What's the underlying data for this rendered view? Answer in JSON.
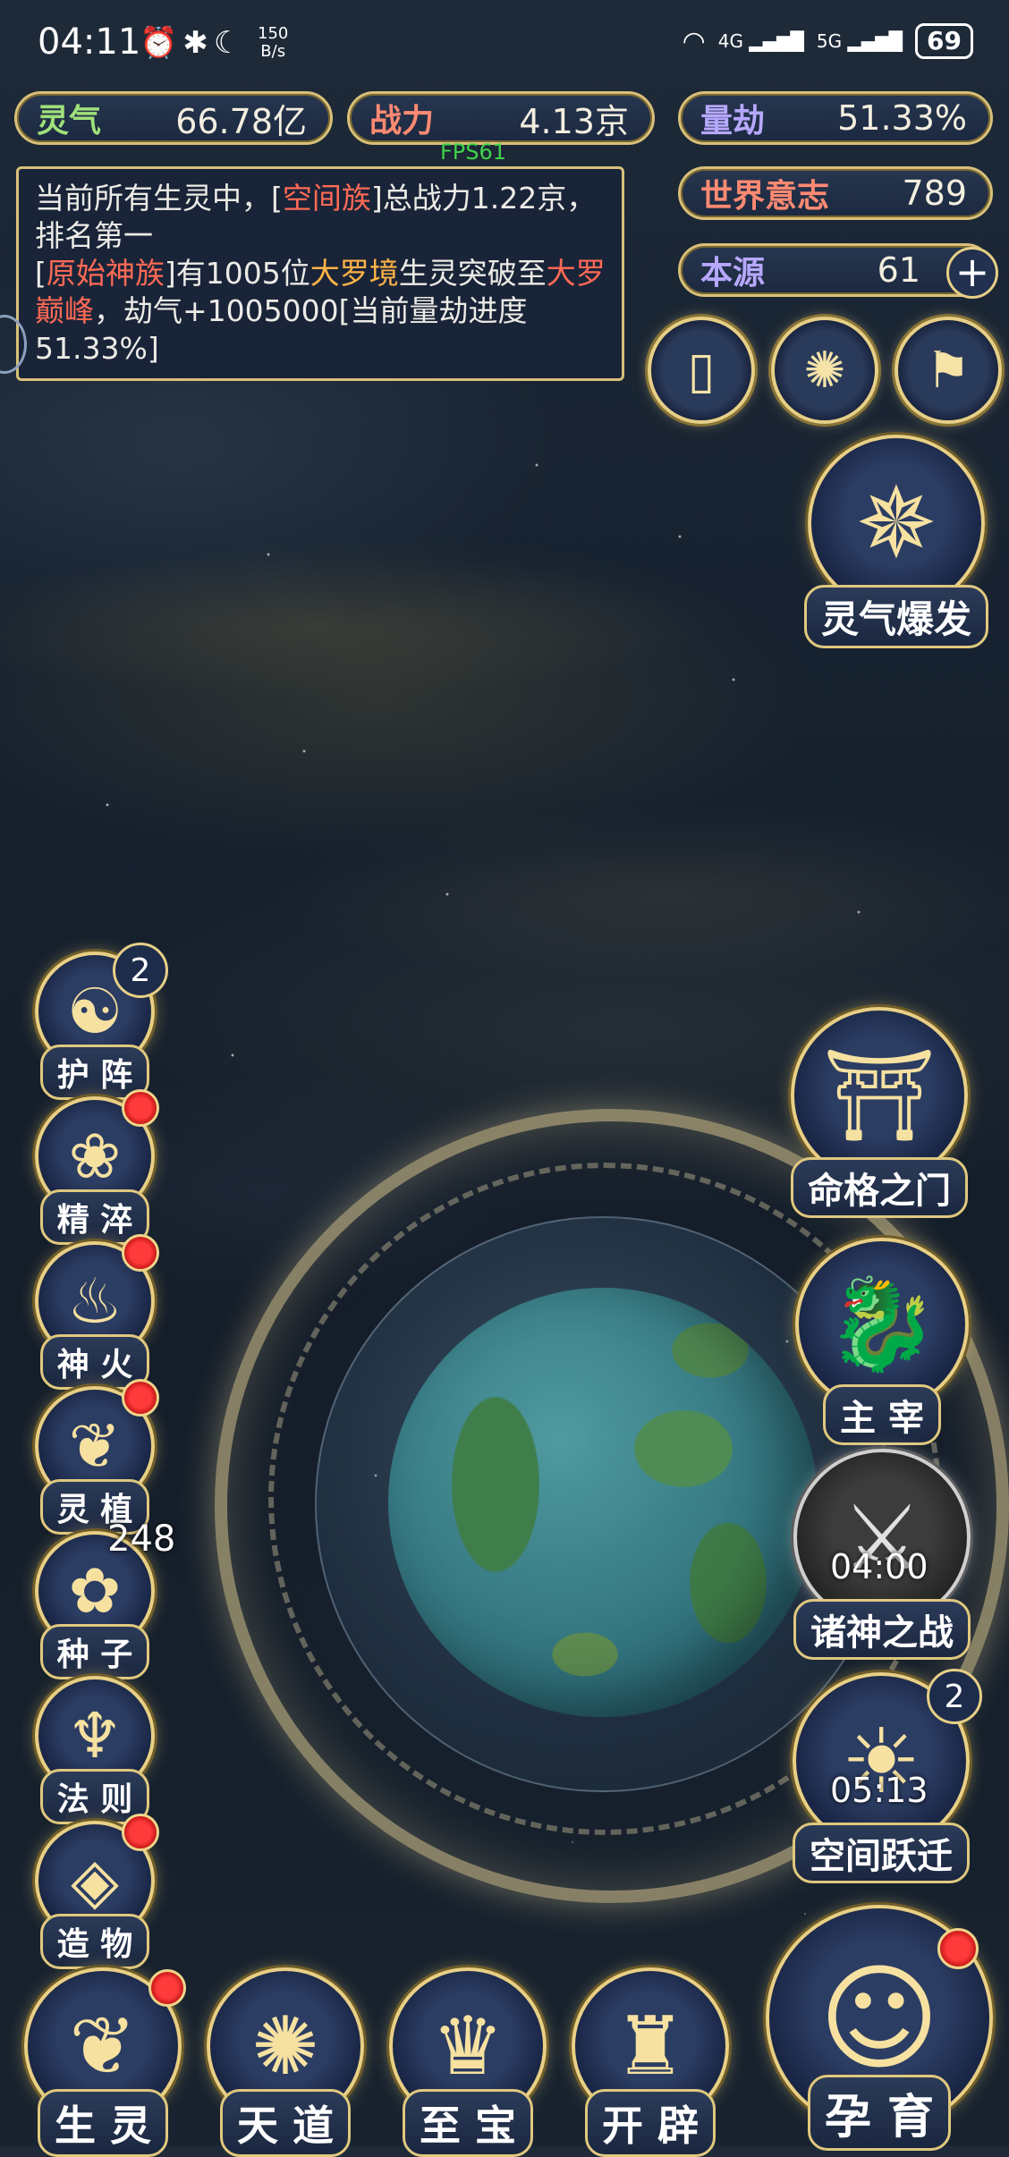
{
  "status_bar": {
    "time": "04:11",
    "icons": [
      "alarm-icon",
      "bluetooth-icon",
      "moon-icon"
    ],
    "net_speed_value": "150",
    "net_speed_unit": "B/s",
    "wifi_icon": "wifi-icon",
    "signal_4g_label": "4G",
    "signal_5g_label": "5G",
    "battery": "69"
  },
  "resources": {
    "lingqi": {
      "label": "灵气",
      "value": "66.78亿"
    },
    "zhanli": {
      "label": "战力",
      "value": "4.13京"
    },
    "liangjie": {
      "label": "量劫",
      "value": "51.33%"
    },
    "shijie_yizhi": {
      "label": "世界意志",
      "value": "789"
    },
    "benyuan": {
      "label": "本源",
      "value": "61"
    }
  },
  "fps": "FPS61",
  "notice": {
    "line1_a": "当前所有生灵中，[",
    "line1_race": "空间族",
    "line1_b": "]总战力1.22京，排名第一",
    "line2_a": "[",
    "line2_race": "原始神族",
    "line2_b": "]有1005位",
    "line2_realm1": "大罗境",
    "line2_c": "生灵突破至",
    "line2_realm2": "大罗巅峰",
    "line2_d": "，劫气+1005000[当前量劫进度51.33%]"
  },
  "top_buttons": [
    "card-icon",
    "swirl-icon",
    "flag-icon"
  ],
  "burst": {
    "label": "灵气爆发"
  },
  "left_menu": [
    {
      "label": "护 阵",
      "badge": "2"
    },
    {
      "label": "精 淬"
    },
    {
      "label": "神 火"
    },
    {
      "label": "灵 植"
    },
    {
      "label": "种 子",
      "count": "248"
    },
    {
      "label": "法 则"
    },
    {
      "label": "造 物"
    }
  ],
  "right_menu": {
    "mingge": {
      "label": "命格之门"
    },
    "zhuzai": {
      "label": "主 宰"
    },
    "zhushen": {
      "label": "诸神之战",
      "timer": "04:00"
    },
    "kongjian": {
      "label": "空间跃迁",
      "timer": "05:13",
      "badge": "2"
    }
  },
  "bottom_nav": [
    {
      "label": "生 灵"
    },
    {
      "label": "天 道"
    },
    {
      "label": "至 宝"
    },
    {
      "label": "开 辟"
    }
  ],
  "yunyu": {
    "label": "孕 育"
  },
  "colors": {
    "gold": "#e8cf84",
    "panel": "#1b2840",
    "red_dot": "#ff3a3a",
    "highlight_red": "#ff6a55",
    "highlight_orange": "#ffb347",
    "fps_green": "#3fd24a"
  }
}
